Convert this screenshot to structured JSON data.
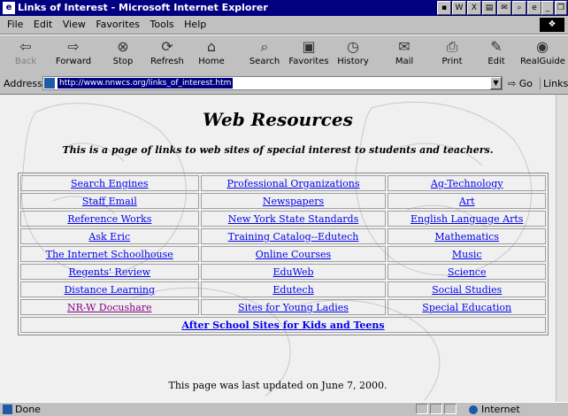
{
  "window": {
    "title": "Links of Interest - Microsoft Internet Explorer",
    "title_icons": [
      "ie-page-icon",
      "w-icon",
      "x-icon",
      "card-icon",
      "mail-icon",
      "search-icon",
      "ie-small-icon"
    ],
    "controls": [
      "minimize-icon",
      "restore-icon",
      "close-icon"
    ]
  },
  "menu": [
    "File",
    "Edit",
    "View",
    "Favorites",
    "Tools",
    "Help"
  ],
  "toolbar": {
    "buttons": [
      {
        "label": "Back",
        "icon": "back-arrow-icon",
        "enabled": false
      },
      {
        "label": "Forward",
        "icon": "forward-arrow-icon",
        "enabled": true
      },
      {
        "label": "Stop",
        "icon": "stop-icon",
        "enabled": true
      },
      {
        "label": "Refresh",
        "icon": "refresh-icon",
        "enabled": true
      },
      {
        "label": "Home",
        "icon": "home-icon",
        "enabled": true
      },
      {
        "label": "Search",
        "icon": "search-icon",
        "enabled": true
      },
      {
        "label": "Favorites",
        "icon": "favorites-icon",
        "enabled": true
      },
      {
        "label": "History",
        "icon": "history-icon",
        "enabled": true
      },
      {
        "label": "Mail",
        "icon": "mail-icon",
        "enabled": true
      },
      {
        "label": "Print",
        "icon": "print-icon",
        "enabled": true
      },
      {
        "label": "Edit",
        "icon": "edit-icon",
        "enabled": true
      },
      {
        "label": "RealGuide",
        "icon": "realguide-icon",
        "enabled": true
      }
    ]
  },
  "address": {
    "label": "Address",
    "url": "http://www.nnwcs.org/links_of_interest.htm",
    "go": "Go",
    "links": "Links"
  },
  "page": {
    "heading": "Web Resources",
    "subheading": "This is  a page of links to web sites of special interest to students and  teachers.",
    "rows": [
      [
        "Search Engines",
        "Professional Organizations",
        "Ag-Technology"
      ],
      [
        "Staff Email",
        "Newspapers",
        "Art"
      ],
      [
        "Reference Works",
        "New York State Standards",
        "English Language Arts"
      ],
      [
        "Ask Eric",
        "Training Catalog--Edutech",
        "Mathematics"
      ],
      [
        "The Internet Schoolhouse",
        "Online Courses",
        "Music"
      ],
      [
        "Regents' Review",
        "EduWeb",
        "Science"
      ],
      [
        "Distance Learning",
        "Edutech",
        "Social Studies"
      ],
      [
        "NR-W Docushare",
        "Sites for Young Ladies",
        "Special Education"
      ]
    ],
    "visited_links": [
      "NR-W Docushare"
    ],
    "after_school": "After School Sites for Kids and Teens",
    "updated": "This page was last updated on June 7, 2000."
  },
  "status": {
    "text": "Done",
    "zone": "Internet"
  },
  "colors": {
    "titlebar": "#000080",
    "link": "#0000ee",
    "visited": "#800080",
    "chrome": "#c0c0c0"
  }
}
